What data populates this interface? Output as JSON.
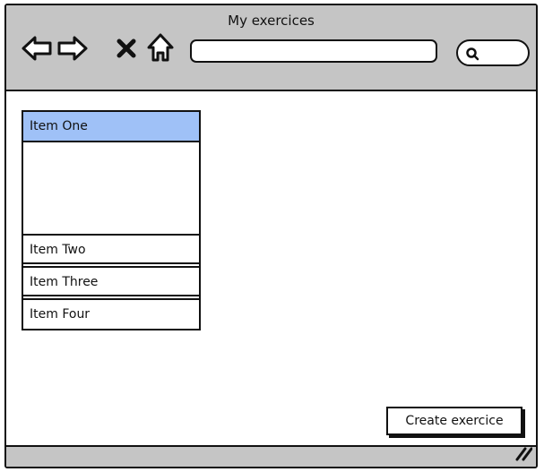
{
  "window": {
    "title": "My exercices"
  },
  "toolbar": {
    "back_icon": "back-arrow-icon",
    "forward_icon": "forward-arrow-icon",
    "stop_icon": "close-x-icon",
    "home_icon": "home-icon",
    "address_value": "",
    "search_icon": "search-icon"
  },
  "list": {
    "items": [
      {
        "label": "Item One",
        "selected": true
      },
      {
        "label": "Item Two",
        "selected": false
      },
      {
        "label": "Item Three",
        "selected": false
      },
      {
        "label": "Item Four",
        "selected": false
      }
    ]
  },
  "actions": {
    "create_label": "Create exercice"
  },
  "colors": {
    "chrome": "#c5c5c5",
    "selection": "#9fc1f7",
    "stroke": "#111111"
  }
}
